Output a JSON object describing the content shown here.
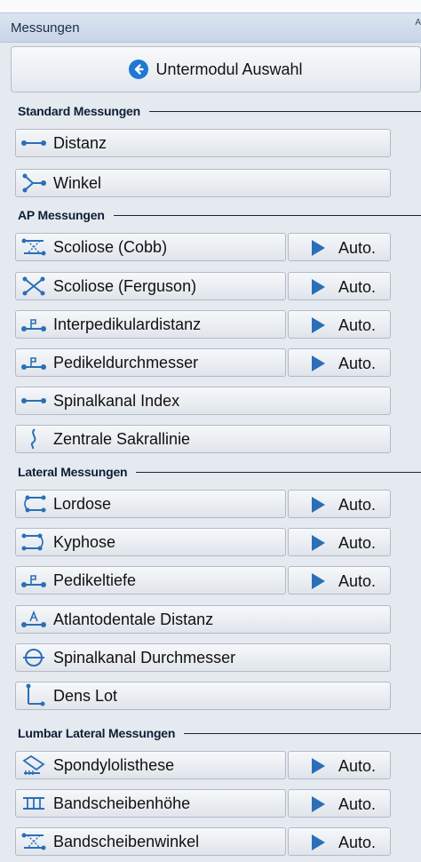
{
  "panel": {
    "title": "Messungen",
    "corner": "A"
  },
  "back": {
    "label": "Untermodul Auswahl"
  },
  "sections": {
    "standard": "Standard Messungen",
    "ap": "AP Messungen",
    "lateral": "Lateral Messungen",
    "lumbar": "Lumbar Lateral Messungen"
  },
  "buttons": {
    "distanz": "Distanz",
    "winkel": "Winkel",
    "scoliose_cobb": "Scoliose (Cobb)",
    "scoliose_ferguson": "Scoliose (Ferguson)",
    "interpedikulardistanz": "Interpedikulardistanz",
    "pedikeldurchmesser": "Pedikeldurchmesser",
    "spinalkanal_index": "Spinalkanal Index",
    "zentrale_sakrallinie": "Zentrale Sakrallinie",
    "lordose": "Lordose",
    "kyphose": "Kyphose",
    "pedikeltiefe": "Pedikeltiefe",
    "atlantodentale_distanz": "Atlantodentale Distanz",
    "spinalkanal_durchmesser": "Spinalkanal Durchmesser",
    "dens_lot": "Dens Lot",
    "spondylolisthese": "Spondylolisthese",
    "bandscheibenhoehe": "Bandscheibenhöhe",
    "bandscheibenwinkel": "Bandscheibenwinkel"
  },
  "auto_label": "Auto.",
  "colors": {
    "accent": "#1f78d1",
    "icon": "#2a6fb8",
    "panel_bg": "#e5eaf0"
  }
}
